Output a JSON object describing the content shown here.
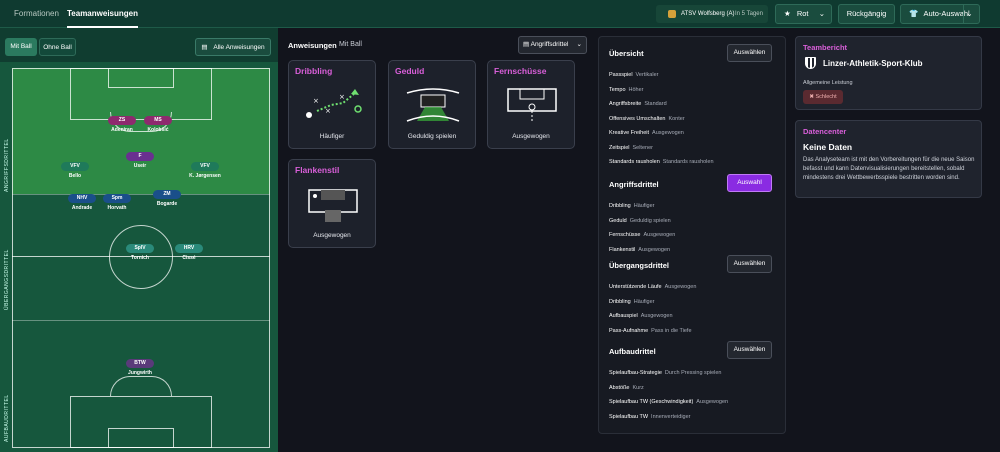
{
  "tabs": [
    "Formationen",
    "Teamanweisungen"
  ],
  "match": {
    "team": "ATSV Wolfsberg (A)",
    "when": "In 5 Tagen"
  },
  "toolbar": {
    "color_label": "Rot",
    "undo_label": "Rückgängig",
    "auto_label": "Auto-Auswahl"
  },
  "ball_tabs": {
    "with": "Mit Ball",
    "without": "Ohne Ball"
  },
  "all_instructions": "Alle Anweisungen",
  "zones": [
    "ANGRIFFSDRITTEL",
    "ÜBERGANGSDRITTEL",
    "AUFBAUDRITTEL"
  ],
  "players": [
    {
      "role": "ZS",
      "name": "Adeniran",
      "color": "#8e2a6e"
    },
    {
      "role": "MS",
      "name": "Kolobšić",
      "color": "#8e2a6e"
    },
    {
      "role": "F",
      "name": "Useir",
      "color": "#6a3090"
    },
    {
      "role": "VFV",
      "name": "Bello",
      "color": "#1f7a5a"
    },
    {
      "role": "VFV",
      "name": "K. Jørgensen",
      "color": "#1f7a5a"
    },
    {
      "role": "NHV",
      "name": "Andrade",
      "color": "#1a4f8a"
    },
    {
      "role": "Spm",
      "name": "Horvath",
      "color": "#1a4f8a"
    },
    {
      "role": "ZM",
      "name": "Bogarde",
      "color": "#1a4f8a"
    },
    {
      "role": "SpIV",
      "name": "Tornich",
      "color": "#2a8a7a"
    },
    {
      "role": "HRV",
      "name": "Cissé",
      "color": "#2a8a7a"
    },
    {
      "role": "BTW",
      "name": "Jungwirth",
      "color": "#5a3a7a"
    }
  ],
  "instructions": {
    "title": "Anweisungen",
    "subtitle": "Mit Ball",
    "dropdown": "Angriffsdrittel"
  },
  "cards": [
    {
      "title": "Dribbling",
      "value": "Häufiger"
    },
    {
      "title": "Geduld",
      "value": "Geduldig spielen"
    },
    {
      "title": "Fernschüsse",
      "value": "Ausgewogen"
    },
    {
      "title": "Flankenstil",
      "value": "Ausgewogen"
    }
  ],
  "overview": {
    "select_label": "Auswählen",
    "sections": [
      {
        "title": "Übersicht",
        "rows": [
          [
            "Passspiel",
            "Vertikaler"
          ],
          [
            "Tempo",
            "Höher"
          ],
          [
            "Angriffsbreite",
            "Standard"
          ],
          [
            "Offensives Umschalten",
            "Konter"
          ],
          [
            "Kreative Freiheit",
            "Ausgewogen"
          ],
          [
            "Zeitspiel",
            "Seltener"
          ],
          [
            "Standards rausholen",
            "Standards rausholen"
          ]
        ]
      },
      {
        "title": "Angriffsdrittel",
        "rows": [
          [
            "Dribbling",
            "Häufiger"
          ],
          [
            "Geduld",
            "Geduldig spielen"
          ],
          [
            "Fernschüsse",
            "Ausgewogen"
          ],
          [
            "Flankenstil",
            "Ausgewogen"
          ]
        ]
      },
      {
        "title": "Übergangsdrittel",
        "rows": [
          [
            "Unterstützende Läufe",
            "Ausgewogen"
          ],
          [
            "Dribbling",
            "Häufiger"
          ],
          [
            "Aufbauspiel",
            "Ausgewogen"
          ],
          [
            "Pass-Aufnahme",
            "Pass in die Tiefe"
          ]
        ]
      },
      {
        "title": "Aufbaudrittel",
        "rows": [
          [
            "Spielaufbau-Strategie",
            "Durch Pressing spielen"
          ],
          [
            "Abstöße",
            "Kurz"
          ],
          [
            "Spielaufbau TW (Geschwindigkeit)",
            "Ausgewogen"
          ],
          [
            "Spielaufbau TW",
            "Innenverteidiger"
          ]
        ]
      }
    ],
    "active_button": "Auswahl"
  },
  "team_report": {
    "title": "Teambericht",
    "club": "Linzer-Athletik-Sport-Klub",
    "label": "Allgemeine Leistung",
    "badge": "Schlecht"
  },
  "data_center": {
    "title": "Datencenter",
    "heading": "Keine Daten",
    "text": "Das Analyseteam ist mit den Vorbereitungen für die neue Saison befasst und kann Datenvisualisierungen bereitstellen, sobald mindestens drei Wettbewerbsspiele bestritten worden sind."
  },
  "colors": {
    "accent": "#d95fd9",
    "pitch": "#16573d",
    "active": "#8a2be2"
  }
}
